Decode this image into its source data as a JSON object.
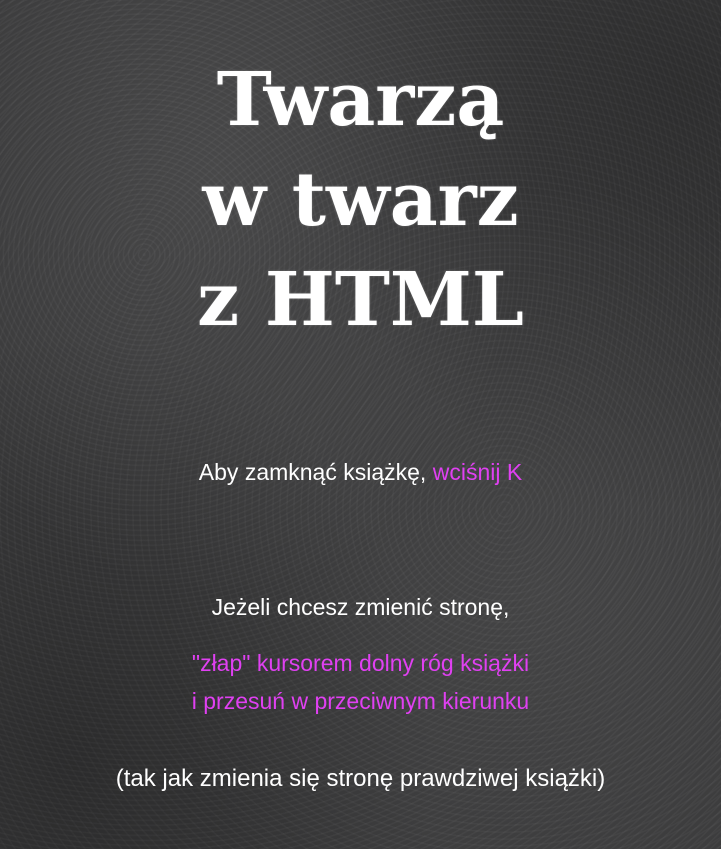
{
  "title": {
    "line1": "Twarzą",
    "line2": "w twarz",
    "line3": "z HTML"
  },
  "instructions": {
    "close_prefix": "Aby zamknąć książkę,",
    "close_action": "wciśnij K",
    "change_page": "Jeżeli chcesz zmienić stronę,",
    "grab_line1": "\"złap\" kursorem dolny róg książki",
    "grab_line2": "i przesuń w przeciwnym kierunku",
    "real_book": "(tak jak zmienia się stronę prawdziwej książki)"
  },
  "colors": {
    "background": "#3a3a3b",
    "text": "#ffffff",
    "accent": "#e040f2"
  }
}
